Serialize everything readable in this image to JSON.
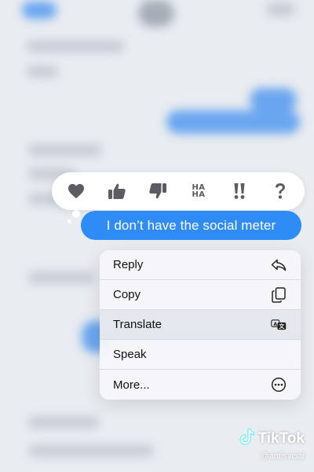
{
  "tapback": {
    "reactions": [
      {
        "icon": "heart-icon"
      },
      {
        "icon": "thumbs-up-icon"
      },
      {
        "icon": "thumbs-down-icon"
      },
      {
        "icon": "haha-icon",
        "text_top": "HA",
        "text_bottom": "HA"
      },
      {
        "icon": "double-exclamation-icon"
      },
      {
        "icon": "question-mark-icon"
      }
    ]
  },
  "message": {
    "text": "I don’t have the social meter",
    "bubble_color": "#2f8cf6"
  },
  "menu": {
    "items": [
      {
        "label": "Reply",
        "icon": "reply-arrow-icon"
      },
      {
        "label": "Copy",
        "icon": "copy-icon"
      },
      {
        "label": "Translate",
        "icon": "translate-icon"
      },
      {
        "label": "Speak",
        "icon": ""
      },
      {
        "label": "More...",
        "icon": "more-ellipsis-icon"
      }
    ]
  },
  "watermark": {
    "brand": "TikTok",
    "handle": "@antisvcial"
  },
  "colors": {
    "accent": "#2f8cf6",
    "icon_gray": "#5b5d63"
  }
}
